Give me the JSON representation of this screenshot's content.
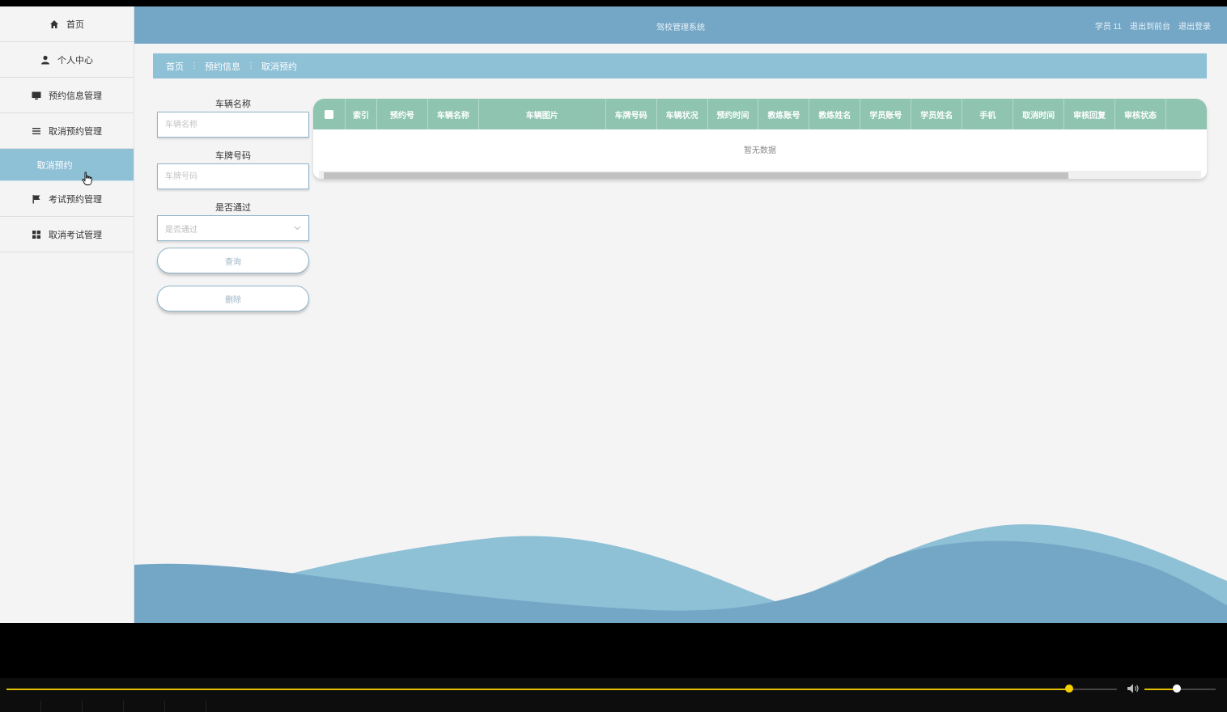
{
  "header": {
    "title": "驾校管理系统",
    "user": "学员 11",
    "back_front": "退出到前台",
    "logout": "退出登录"
  },
  "sidebar": {
    "items": [
      {
        "label": "首页",
        "icon": "home-icon"
      },
      {
        "label": "个人中心",
        "icon": "user-icon"
      },
      {
        "label": "预约信息管理",
        "icon": "monitor-icon"
      },
      {
        "label": "取消预约管理",
        "icon": "list-icon"
      },
      {
        "label": "取消预约",
        "icon": "",
        "active": true
      },
      {
        "label": "考试预约管理",
        "icon": "flag-icon"
      },
      {
        "label": "取消考试管理",
        "icon": "grid-icon"
      }
    ]
  },
  "breadcrumb": [
    "首页",
    "预约信息",
    "取消预约"
  ],
  "search": {
    "vehicle_name_label": "车辆名称",
    "vehicle_name_placeholder": "车辆名称",
    "plate_label": "车牌号码",
    "plate_placeholder": "车牌号码",
    "passed_label": "是否通过",
    "passed_placeholder": "是否通过",
    "query_button": "查询",
    "delete_button": "删除"
  },
  "table": {
    "columns": [
      "索引",
      "预约号",
      "车辆名称",
      "车辆图片",
      "车牌号码",
      "车辆状况",
      "预约时间",
      "教练账号",
      "教练姓名",
      "学员账号",
      "学员姓名",
      "手机",
      "取消时间",
      "审核回复",
      "审核状态"
    ],
    "empty_text": "暂无数据"
  },
  "colors": {
    "header_bg": "#74a6c6",
    "breadcrumb_bg": "#8ec0d6",
    "table_header_bg": "#8ec4b0",
    "wave_light": "#8ec0d6",
    "wave_dark": "#74a6c6"
  }
}
